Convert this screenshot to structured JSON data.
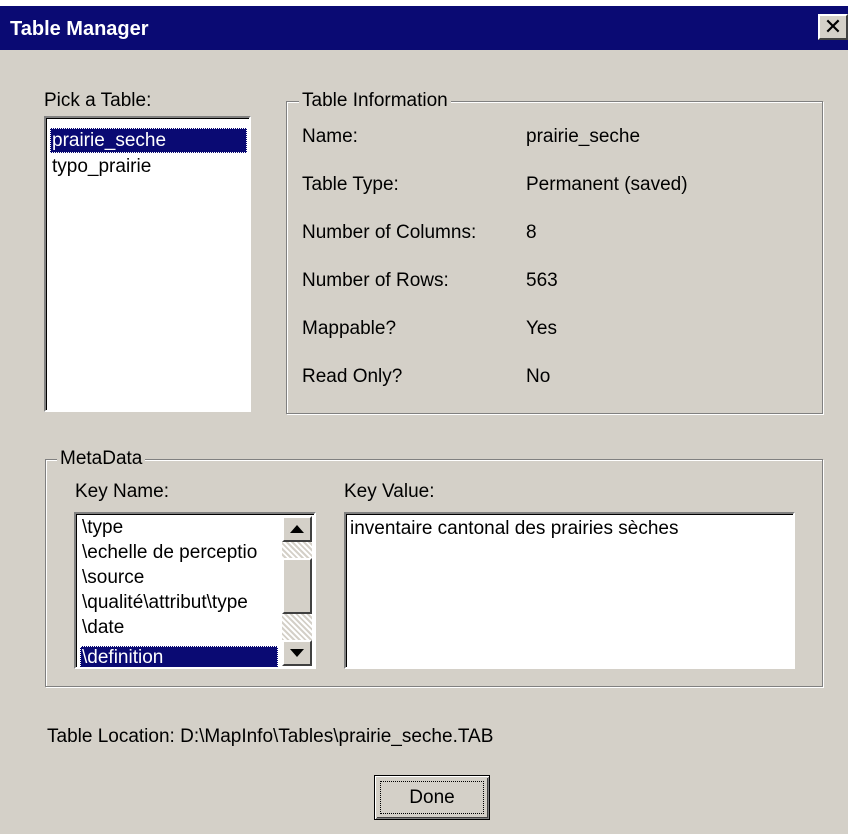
{
  "window": {
    "title": "Table Manager",
    "close_glyph": "✕"
  },
  "pick_table": {
    "label": "Pick a Table:",
    "items": [
      "prairie_seche",
      "typo_prairie"
    ],
    "selected_index": 0
  },
  "table_info": {
    "legend": "Table Information",
    "rows": [
      {
        "label": "Name:",
        "value": "prairie_seche"
      },
      {
        "label": "Table Type:",
        "value": "Permanent (saved)"
      },
      {
        "label": "Number of Columns:",
        "value": "8"
      },
      {
        "label": "Number of Rows:",
        "value": "563"
      },
      {
        "label": "Mappable?",
        "value": "Yes"
      },
      {
        "label": "Read Only?",
        "value": "No"
      }
    ]
  },
  "metadata": {
    "legend": "MetaData",
    "key_name_label": "Key Name:",
    "key_value_label": "Key Value:",
    "keys": [
      "\\type",
      "\\echelle de perceptio",
      "\\source",
      "\\qualité\\attribut\\type",
      "\\date",
      "\\definition"
    ],
    "selected_key_index": 5,
    "key_value": "inventaire cantonal des prairies sèches"
  },
  "location": {
    "text": "Table Location: D:\\MapInfo\\Tables\\prairie_seche.TAB"
  },
  "buttons": {
    "done": "Done"
  },
  "colors": {
    "titlebar": "#0a0a73",
    "dialog_face": "#d4d0c8",
    "selection": "#0a0a73"
  }
}
